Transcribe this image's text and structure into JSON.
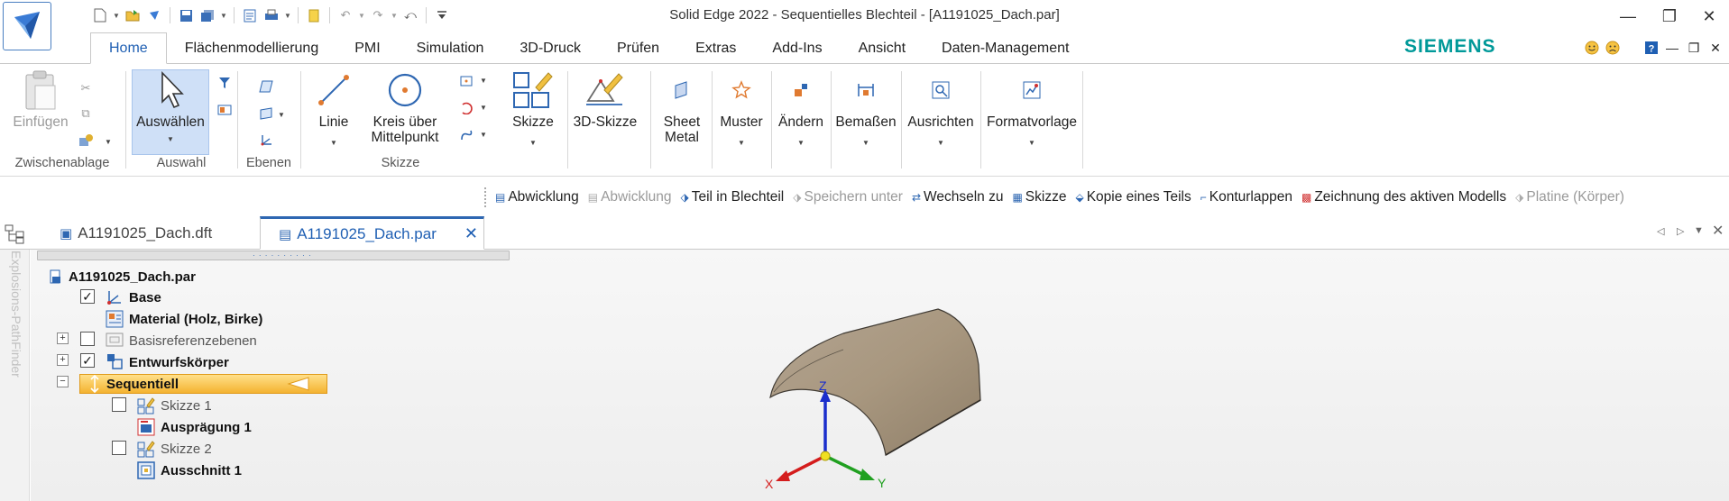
{
  "window": {
    "title": "Solid Edge 2022 - Sequentielles Blechteil - [A1191025_Dach.par]",
    "controls": {
      "minimize": "—",
      "restore": "❐",
      "close": "✕"
    }
  },
  "quick_access": {
    "items": [
      "new-icon",
      "open-icon",
      "logo-icon",
      "save-icon",
      "save-all-icon",
      "properties-icon",
      "print-icon",
      "notes-icon",
      "undo-icon",
      "redo-icon",
      "repeat-icon",
      "customize-icon"
    ]
  },
  "tabs": [
    {
      "label": "Home",
      "active": true
    },
    {
      "label": "Flächenmodellierung"
    },
    {
      "label": "PMI"
    },
    {
      "label": "Simulation"
    },
    {
      "label": "3D-Druck"
    },
    {
      "label": "Prüfen"
    },
    {
      "label": "Extras"
    },
    {
      "label": "Add-Ins"
    },
    {
      "label": "Ansicht"
    },
    {
      "label": "Daten-Management"
    }
  ],
  "brand": "SIEMENS",
  "ribbon": {
    "clipboard": {
      "label": "Zwischenablage",
      "paste": "Einfügen"
    },
    "selection": {
      "label": "Auswahl",
      "select": "Auswählen"
    },
    "planes": {
      "label": "Ebenen"
    },
    "sketch": {
      "label": "Skizze",
      "line": "Linie",
      "circle": "Kreis über Mittelpunkt",
      "sketch_btn": "Skizze"
    },
    "sketch3d": "3D-Skizze",
    "sheet_metal": "Sheet Metal",
    "pattern": "Muster",
    "modify": "Ändern",
    "dimension": "Bemaßen",
    "align": "Ausrichten",
    "style": "Formatvorlage"
  },
  "command_bar": [
    {
      "label": "Abwicklung",
      "enabled": true
    },
    {
      "label": "Abwicklung",
      "enabled": false
    },
    {
      "label": "Teil in Blechteil",
      "enabled": true
    },
    {
      "label": "Speichern unter",
      "enabled": false
    },
    {
      "label": "Wechseln zu",
      "enabled": true
    },
    {
      "label": "Skizze",
      "enabled": true
    },
    {
      "label": "Kopie eines Teils",
      "enabled": true
    },
    {
      "label": "Konturlappen",
      "enabled": true
    },
    {
      "label": "Zeichnung des aktiven Modells",
      "enabled": true
    },
    {
      "label": "Platine (Körper)",
      "enabled": false
    }
  ],
  "documents": [
    {
      "name": "A1191025_Dach.dft",
      "active": false
    },
    {
      "name": "A1191025_Dach.par",
      "active": true
    }
  ],
  "side_panel_label": "Explosions-PathFinder",
  "pathfinder": {
    "root": "A1191025_Dach.par",
    "nodes": [
      {
        "label": "Base",
        "checked": true
      },
      {
        "label": "Material (Holz, Birke)"
      },
      {
        "label": "Basisreferenzebenen",
        "checked": false,
        "expander": "+"
      },
      {
        "label": "Entwurfskörper",
        "checked": true,
        "expander": "+"
      },
      {
        "label": "Sequentiell",
        "expander": "−"
      },
      {
        "label": "Skizze 1",
        "checked": false
      },
      {
        "label": "Ausprägung 1"
      },
      {
        "label": "Skizze 2",
        "checked": false
      },
      {
        "label": "Ausschnitt 1"
      }
    ]
  },
  "triad": {
    "x": "X",
    "y": "Y",
    "z": "Z"
  },
  "colors": {
    "accent": "#1f5fb3",
    "brand": "#009999",
    "model": "#a89882",
    "highlight": "#f4b331"
  }
}
